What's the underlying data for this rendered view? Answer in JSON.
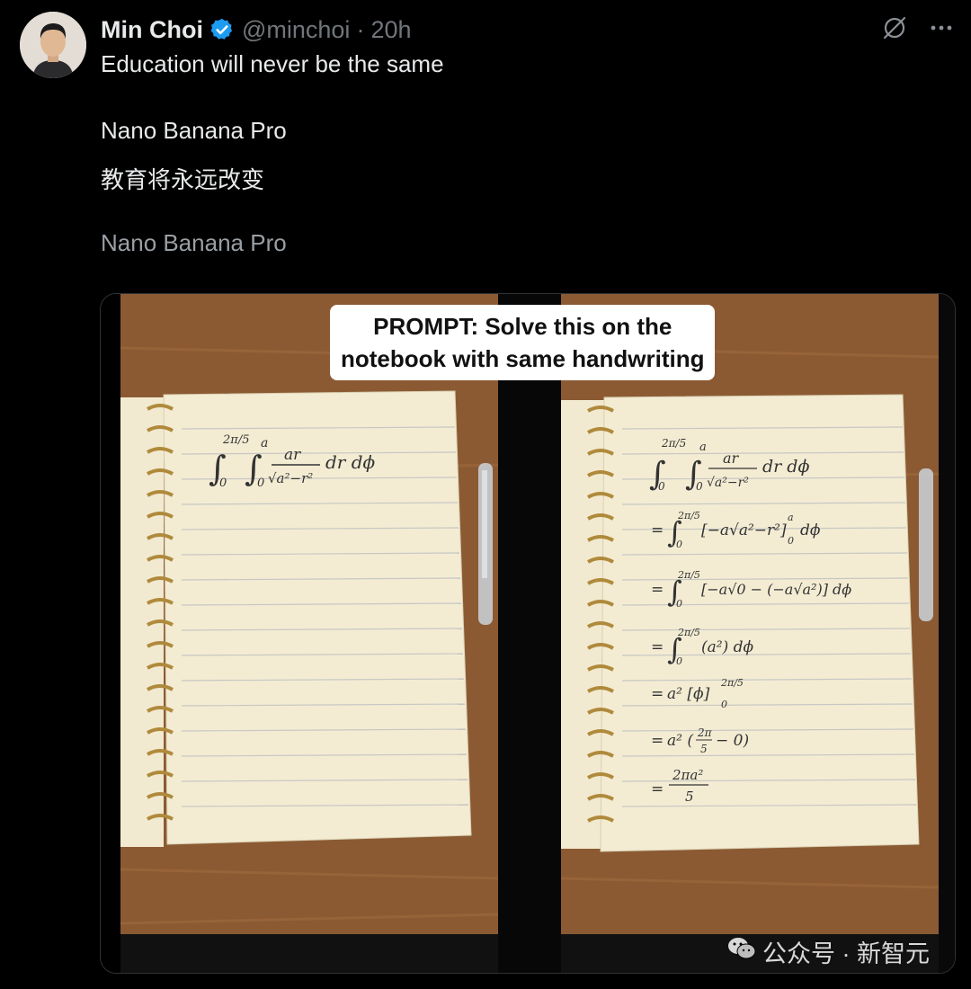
{
  "author": {
    "name": "Min Choi",
    "handle": "@minchoi",
    "separator": "·",
    "time": "20h"
  },
  "tweet": {
    "lines": [
      "Education will never be the same",
      "Nano Banana Pro",
      "教育将永远改变",
      "Nano Banana Pro"
    ]
  },
  "media": {
    "prompt_line1": "PROMPT: Solve this on the",
    "prompt_line2": "notebook with same handwriting",
    "watermark_text": "公众号 · 新智元"
  },
  "icons": [
    "avatar",
    "verified-badge-icon",
    "grok-icon",
    "more-icon",
    "wechat-icon"
  ],
  "colors": {
    "background": "#000000",
    "text": "#e7e9ea",
    "muted": "#71767b",
    "verified": "#1d9bf0"
  }
}
